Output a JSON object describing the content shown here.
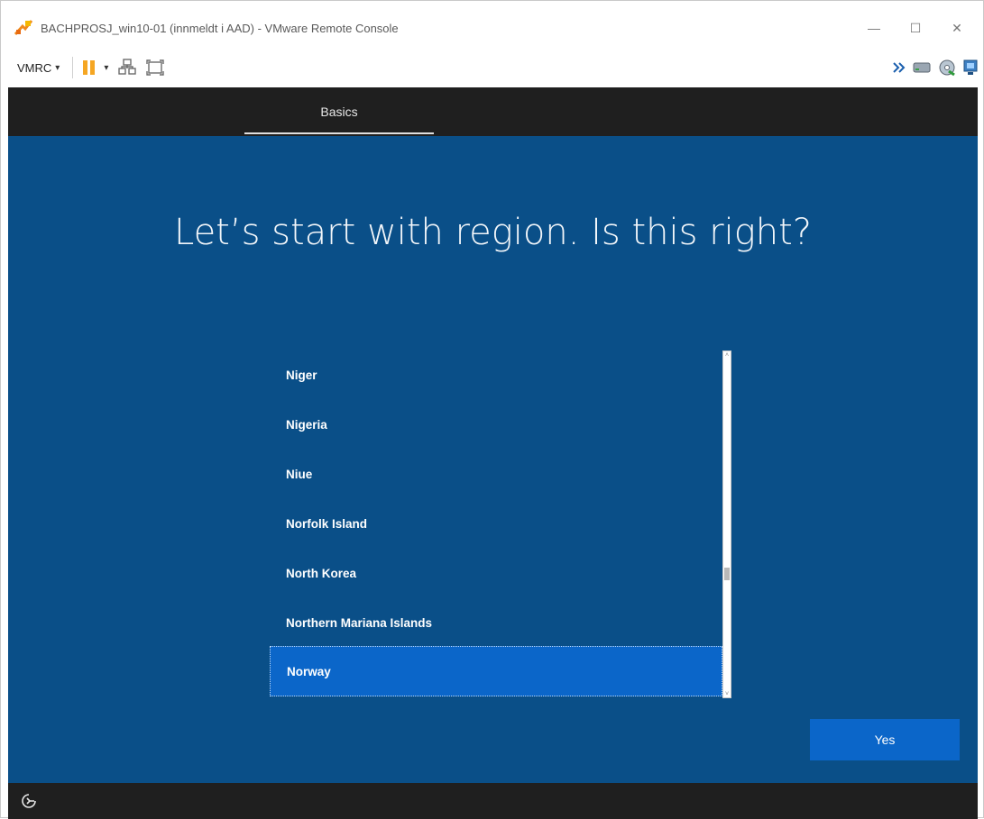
{
  "window": {
    "title": "BACHPROSJ_win10-01 (innmeldt i AAD) - VMware Remote Console",
    "minimize_glyph": "—",
    "maximize_glyph": "☐",
    "close_glyph": "✕"
  },
  "toolbar": {
    "vmrc_label": "VMRC",
    "vmrc_caret": "▾",
    "power_caret": "▾",
    "icons": [
      "pause-icon",
      "send-ctrl-alt-del-icon",
      "fullscreen-icon",
      "chevron-double-right-icon",
      "removable-devices-icon",
      "cd-drive-icon",
      "network-icon"
    ]
  },
  "oobe": {
    "tab_label": "Basics",
    "heading": "Let’s start with region. Is this right?",
    "regions": [
      "Niger",
      "Nigeria",
      "Niue",
      "Norfolk Island",
      "North Korea",
      "Northern Mariana Islands",
      "Norway"
    ],
    "selected_region": "Norway",
    "yes_button": "Yes",
    "scroll_up_glyph": "˄",
    "scroll_down_glyph": "˅",
    "accessibility_icon": "accessibility-icon"
  },
  "colors": {
    "oobe_background": "#0a4f88",
    "selection": "#0b66c9",
    "header_bar": "#1f1f1f",
    "pause_orange": "#f5a623"
  }
}
